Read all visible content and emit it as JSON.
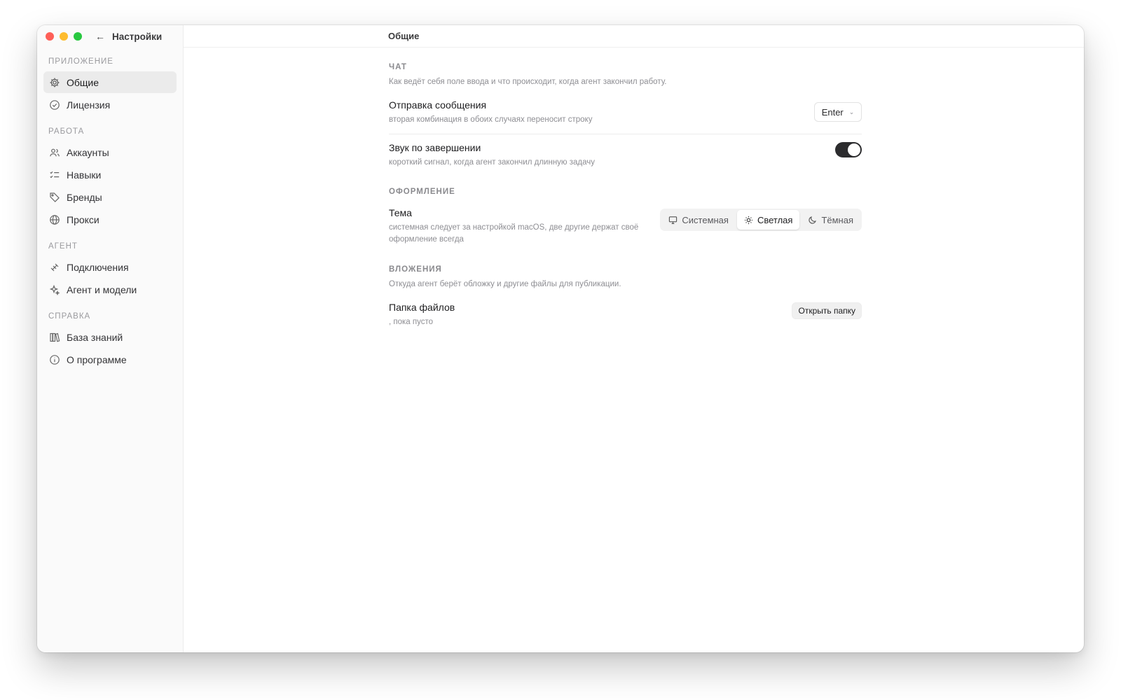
{
  "titlebar": {
    "back_label": "Настройки"
  },
  "sidebar": {
    "sections": [
      {
        "title": "ПРИЛОЖЕНИЕ",
        "items": [
          {
            "label": "Общие",
            "icon": "gear-icon",
            "active": true
          },
          {
            "label": "Лицензия",
            "icon": "check-circle-icon"
          }
        ]
      },
      {
        "title": "РАБОТА",
        "items": [
          {
            "label": "Аккаунты",
            "icon": "users-icon"
          },
          {
            "label": "Навыки",
            "icon": "list-check-icon"
          },
          {
            "label": "Бренды",
            "icon": "tag-icon"
          },
          {
            "label": "Прокси",
            "icon": "globe-icon"
          }
        ]
      },
      {
        "title": "АГЕНТ",
        "items": [
          {
            "label": "Подключения",
            "icon": "plug-icon"
          },
          {
            "label": "Агент и модели",
            "icon": "sparkle-icon"
          }
        ]
      },
      {
        "title": "СПРАВКА",
        "items": [
          {
            "label": "База знаний",
            "icon": "library-icon"
          },
          {
            "label": "О программе",
            "icon": "info-icon"
          }
        ]
      }
    ]
  },
  "main": {
    "title": "Общие",
    "chat": {
      "title": "ЧАТ",
      "desc": "Как ведёт себя поле ввода и что происходит, когда агент закончил работу.",
      "send": {
        "label": "Отправка сообщения",
        "hint": "вторая комбинация в обоих случаях переносит строку",
        "value": "Enter"
      },
      "sound": {
        "label": "Звук по завершении",
        "hint": "короткий сигнал, когда агент закончил длинную задачу",
        "enabled": true
      }
    },
    "appearance": {
      "title": "ОФОРМЛЕНИЕ",
      "theme": {
        "label": "Тема",
        "hint": "системная следует за настройкой macOS, две другие держат своё оформление всегда",
        "options": [
          "Системная",
          "Светлая",
          "Тёмная"
        ],
        "selected": "Светлая"
      }
    },
    "attachments": {
      "title": "ВЛОЖЕНИЯ",
      "desc": "Откуда агент берёт обложку и другие файлы для публикации.",
      "folder": {
        "label": "Папка файлов",
        "hint": ", пока пусто",
        "button": "Открыть папку"
      }
    }
  },
  "colors": {
    "accent": "#2c2c2e",
    "active_bg": "#ebebeb",
    "sidebar_bg": "#fafafa"
  }
}
